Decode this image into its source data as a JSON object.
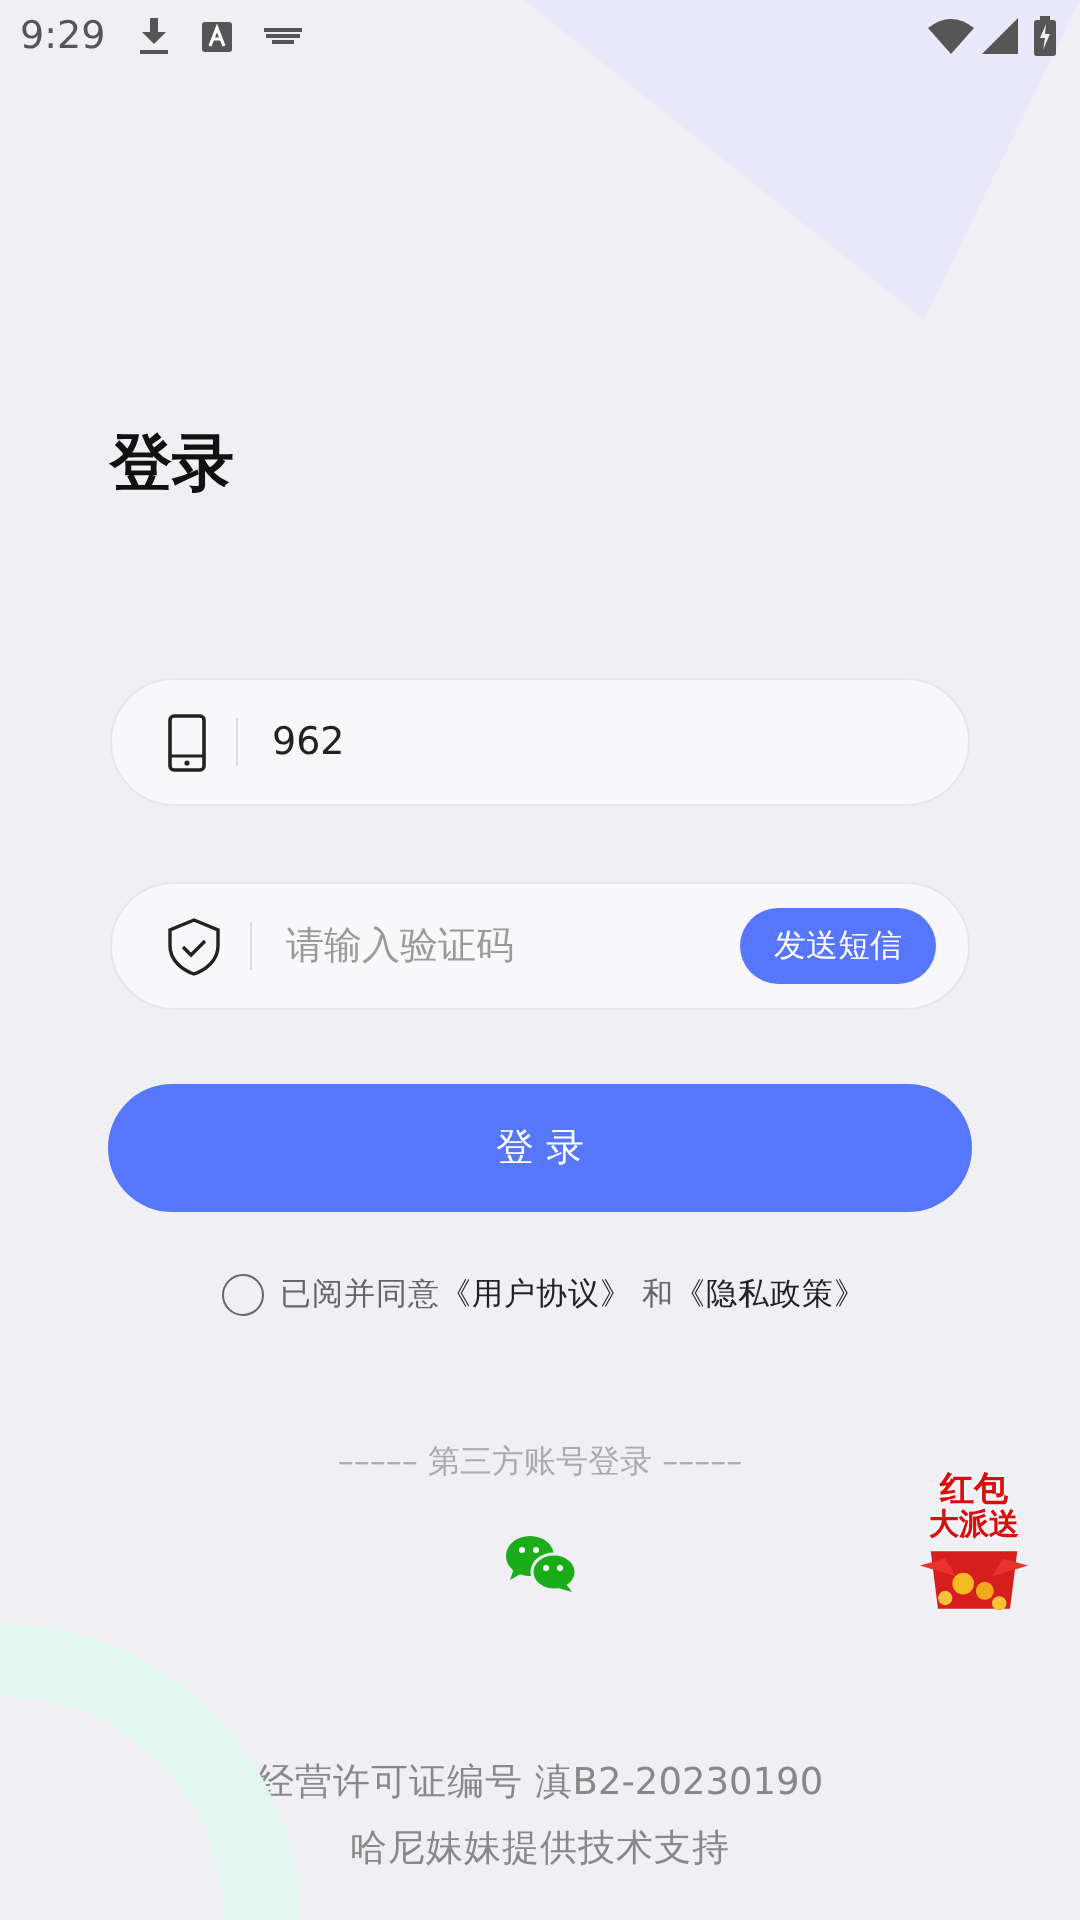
{
  "status_bar": {
    "time": "9:29"
  },
  "title": "登录",
  "phone_field": {
    "value": "962"
  },
  "code_field": {
    "placeholder": "请输入验证码",
    "send_button": "发送短信"
  },
  "login_button": "登 录",
  "agreement": {
    "checked": false,
    "prefix": "已阅并同意",
    "terms_link": "《用户协议》",
    "joiner": "和",
    "privacy_link": "《隐私政策》"
  },
  "third_party": {
    "heading": "––––– 第三方账号登录 –––––"
  },
  "promo": {
    "line_1": "红包",
    "line_2": "大派送"
  },
  "footer": [
    "经营许可证编号 滇B2-20230190",
    "哈尼妹妹提供技术支持"
  ]
}
